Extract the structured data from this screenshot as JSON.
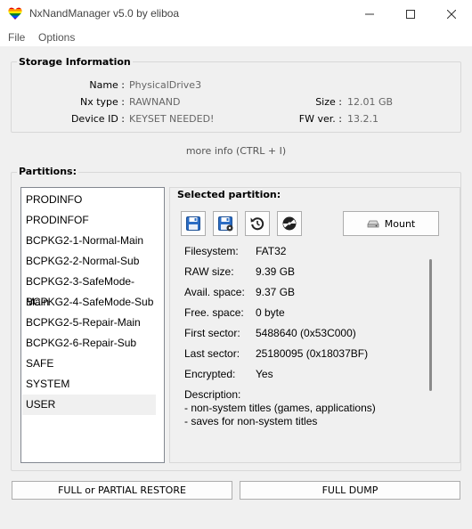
{
  "window": {
    "title": "NxNandManager v5.0 by eliboa"
  },
  "menu": {
    "file": "File",
    "options": "Options"
  },
  "storage": {
    "group_title": "Storage Information",
    "name_label": "Name :",
    "name_value": "PhysicalDrive3",
    "nx_type_label": "Nx type :",
    "nx_type_value": "RAWNAND",
    "device_id_label": "Device ID :",
    "device_id_value": "KEYSET NEEDED!",
    "size_label": "Size :",
    "size_value": "12.01 GB",
    "fw_label": "FW ver. :",
    "fw_value": "13.2.1",
    "more_info": "more info (CTRL + I)"
  },
  "partitions": {
    "group_title": "Partitions:",
    "items": [
      "PRODINFO",
      "PRODINFOF",
      "BCPKG2-1-Normal-Main",
      "BCPKG2-2-Normal-Sub",
      "BCPKG2-3-SafeMode-Main",
      "BCPKG2-4-SafeMode-Sub",
      "BCPKG2-5-Repair-Main",
      "BCPKG2-6-Repair-Sub",
      "SAFE",
      "SYSTEM",
      "USER"
    ],
    "selected": "USER"
  },
  "selected_partition": {
    "title": "Selected partition:",
    "mount_label": "Mount",
    "filesystem_label": "Filesystem:",
    "filesystem_value": "FAT32",
    "raw_size_label": "RAW size:",
    "raw_size_value": "9.39 GB",
    "avail_space_label": "Avail. space:",
    "avail_space_value": "9.37 GB",
    "free_space_label": "Free. space:",
    "free_space_value": "0 byte",
    "first_sector_label": "First sector:",
    "first_sector_value": "5488640 (0x53C000)",
    "last_sector_label": "Last sector:",
    "last_sector_value": "25180095 (0x18037BF)",
    "encrypted_label": "Encrypted:",
    "encrypted_value": "Yes",
    "description_label": "Description:",
    "description_lines": [
      "- non-system titles (games, applications)",
      "- saves for non-system titles"
    ]
  },
  "buttons": {
    "restore": "FULL or PARTIAL RESTORE",
    "dump": "FULL DUMP"
  }
}
